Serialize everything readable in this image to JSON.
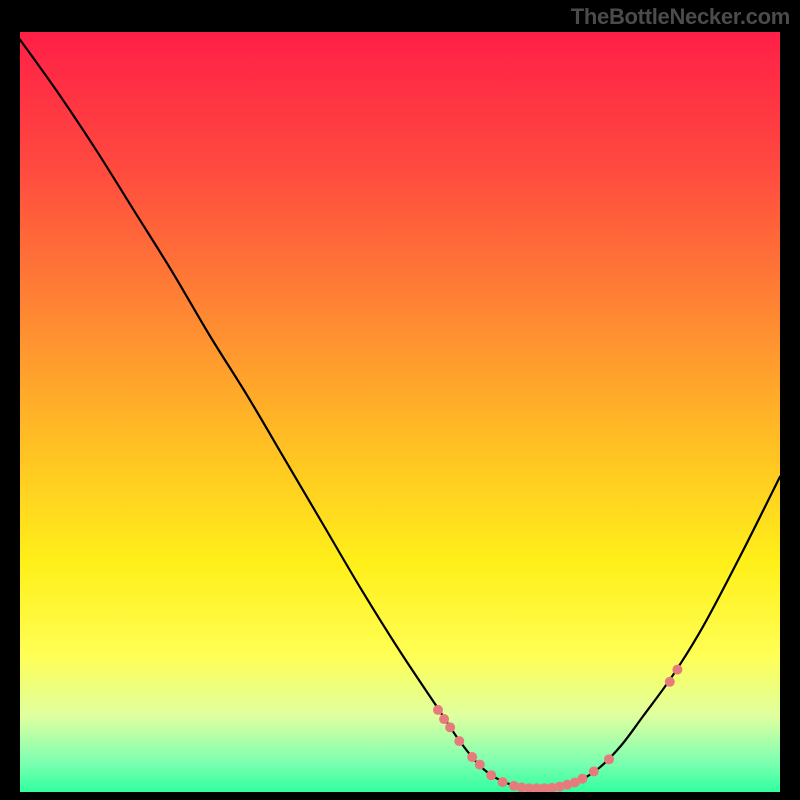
{
  "attribution": "TheBottleNecker.com",
  "chart_data": {
    "type": "line",
    "title": "",
    "xlabel": "",
    "ylabel": "",
    "xlim": [
      0,
      100
    ],
    "ylim": [
      0,
      100
    ],
    "curve_points": [
      {
        "x": 0.0,
        "y": 99.0
      },
      {
        "x": 5.0,
        "y": 92.0
      },
      {
        "x": 10.0,
        "y": 84.5
      },
      {
        "x": 15.0,
        "y": 76.5
      },
      {
        "x": 20.0,
        "y": 68.5
      },
      {
        "x": 25.0,
        "y": 60.0
      },
      {
        "x": 30.0,
        "y": 52.0
      },
      {
        "x": 35.0,
        "y": 43.5
      },
      {
        "x": 40.0,
        "y": 35.0
      },
      {
        "x": 45.0,
        "y": 26.5
      },
      {
        "x": 50.0,
        "y": 18.5
      },
      {
        "x": 55.0,
        "y": 11.0
      },
      {
        "x": 58.0,
        "y": 6.5
      },
      {
        "x": 61.0,
        "y": 3.0
      },
      {
        "x": 64.0,
        "y": 1.2
      },
      {
        "x": 67.0,
        "y": 0.5
      },
      {
        "x": 70.0,
        "y": 0.5
      },
      {
        "x": 73.0,
        "y": 1.2
      },
      {
        "x": 76.0,
        "y": 3.0
      },
      {
        "x": 79.0,
        "y": 6.0
      },
      {
        "x": 82.0,
        "y": 10.0
      },
      {
        "x": 86.0,
        "y": 15.5
      },
      {
        "x": 90.0,
        "y": 22.0
      },
      {
        "x": 95.0,
        "y": 31.5
      },
      {
        "x": 100.0,
        "y": 41.5
      }
    ],
    "markers": [
      {
        "x": 55.0,
        "y": 10.8
      },
      {
        "x": 55.8,
        "y": 9.6
      },
      {
        "x": 56.6,
        "y": 8.5
      },
      {
        "x": 57.8,
        "y": 6.7
      },
      {
        "x": 59.5,
        "y": 4.6
      },
      {
        "x": 60.5,
        "y": 3.6
      },
      {
        "x": 62.0,
        "y": 2.2
      },
      {
        "x": 63.5,
        "y": 1.3
      },
      {
        "x": 65.0,
        "y": 0.8
      },
      {
        "x": 66.0,
        "y": 0.6
      },
      {
        "x": 67.0,
        "y": 0.5
      },
      {
        "x": 68.0,
        "y": 0.5
      },
      {
        "x": 69.0,
        "y": 0.5
      },
      {
        "x": 70.0,
        "y": 0.55
      },
      {
        "x": 71.0,
        "y": 0.7
      },
      {
        "x": 72.0,
        "y": 0.95
      },
      {
        "x": 73.0,
        "y": 1.25
      },
      {
        "x": 74.0,
        "y": 1.75
      },
      {
        "x": 75.5,
        "y": 2.7
      },
      {
        "x": 77.5,
        "y": 4.3
      },
      {
        "x": 85.5,
        "y": 14.5
      },
      {
        "x": 86.5,
        "y": 16.1
      }
    ],
    "background_gradient_stops": [
      {
        "offset": 0.0,
        "color": "#ff1f47"
      },
      {
        "offset": 0.18,
        "color": "#ff4a3f"
      },
      {
        "offset": 0.38,
        "color": "#ff8a32"
      },
      {
        "offset": 0.55,
        "color": "#ffc223"
      },
      {
        "offset": 0.7,
        "color": "#fff01a"
      },
      {
        "offset": 0.82,
        "color": "#ffff55"
      },
      {
        "offset": 0.9,
        "color": "#dfffa0"
      },
      {
        "offset": 0.96,
        "color": "#7fffb0"
      },
      {
        "offset": 1.0,
        "color": "#30ffa0"
      }
    ],
    "marker_color": "#e77b7b",
    "curve_color": "#000000",
    "curve_width": 2.2,
    "marker_radius": 5
  }
}
